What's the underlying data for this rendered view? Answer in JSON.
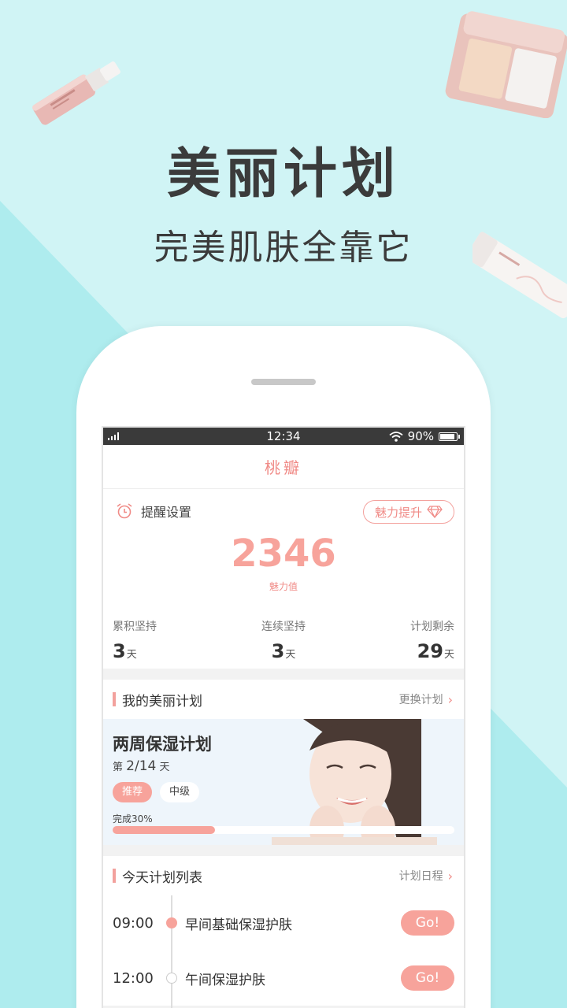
{
  "promo": {
    "headline": "美丽计划",
    "subline": "完美肌肤全靠它"
  },
  "colors": {
    "accent": "#f7a39b",
    "accent_text": "#f08b87",
    "background": "#d0f4f5",
    "background_diagonal": "#aeecee"
  },
  "status_bar": {
    "time": "12:34",
    "battery": "90%",
    "battery_level": 0.9
  },
  "app": {
    "title": "桃瓣"
  },
  "summary": {
    "reminder_label": "提醒设置",
    "charm_button": "魅力提升",
    "score": "2346",
    "score_label": "魅力值",
    "stats": [
      {
        "label": "累积坚持",
        "value": "3",
        "unit": "天"
      },
      {
        "label": "连续坚持",
        "value": "3",
        "unit": "天"
      },
      {
        "label": "计划剩余",
        "value": "29",
        "unit": "天"
      }
    ]
  },
  "my_plan": {
    "section_title": "我的美丽计划",
    "switch_link": "更换计划",
    "name": "两周保湿计划",
    "day_prefix": "第",
    "day_value": "2/14",
    "day_suffix": "天",
    "tag_recommended": "推荐",
    "tag_level": "中级",
    "progress_label": "完成30%",
    "progress": 0.3
  },
  "today": {
    "section_title": "今天计划列表",
    "schedule_link": "计划日程",
    "tasks": [
      {
        "time": "09:00",
        "name": "早间基础保湿护肤",
        "button": "Go!",
        "status": "active"
      },
      {
        "time": "12:00",
        "name": "午间保湿护肤",
        "button": "Go!",
        "status": "idle"
      }
    ]
  },
  "icons": {
    "alarm": "alarm-clock-icon",
    "diamond": "diamond-icon",
    "chevron": "chevron-right-icon",
    "wifi": "wifi-icon",
    "signal": "signal-icon",
    "battery": "battery-icon"
  }
}
